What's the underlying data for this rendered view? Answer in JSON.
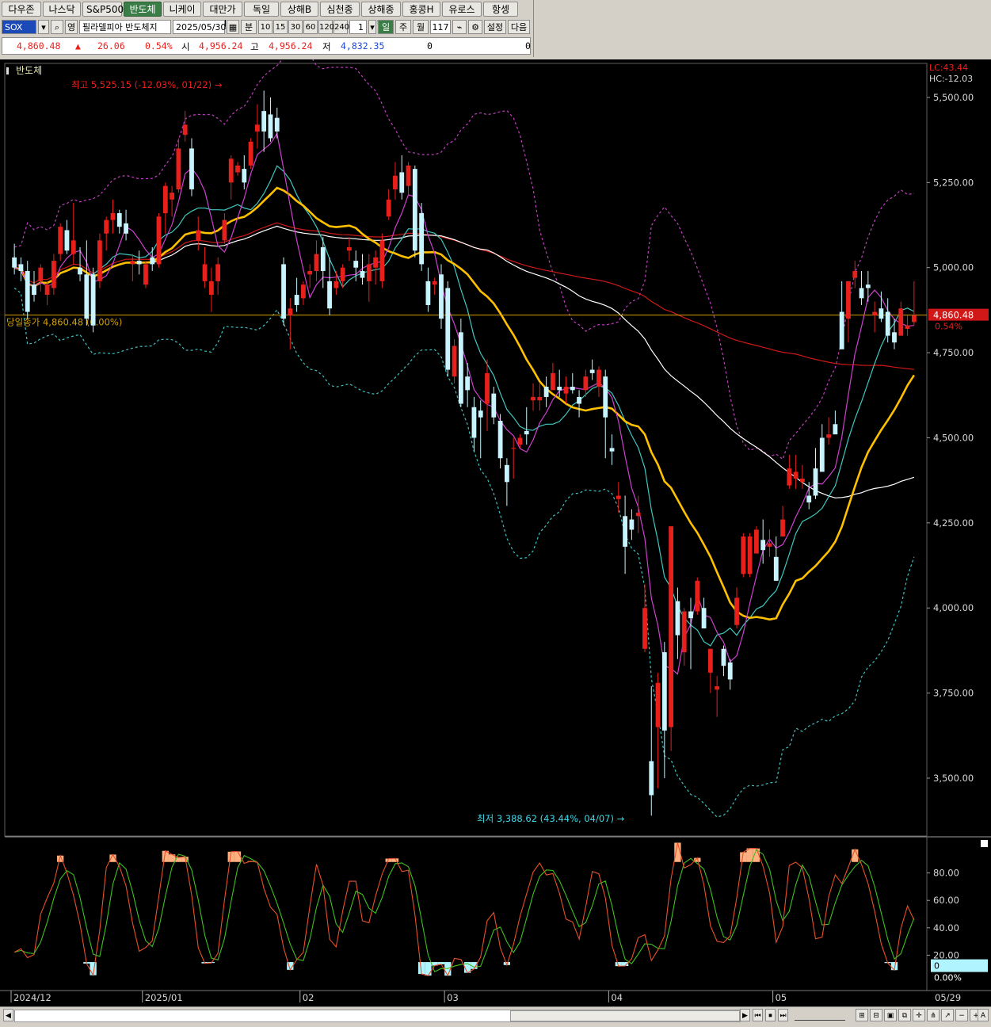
{
  "index_tabs": [
    "다우존스",
    "나스닥",
    "S&P500",
    "반도체",
    "니케이",
    "대만가권",
    "독일",
    "상해B",
    "심천종합",
    "상해종합",
    "홍콩H",
    "유로스톡",
    "항셍"
  ],
  "active_tab": 3,
  "toolbar": {
    "symbol": "SOX",
    "name": "필라델피아 반도체지",
    "date": "2025/05/30",
    "unit": "분",
    "periods": [
      "10",
      "15",
      "30",
      "60",
      "120",
      "240"
    ],
    "count": "1",
    "day": "일",
    "week": "주",
    "month": "월",
    "bars": "117",
    "settings": "설정",
    "next": "다음"
  },
  "quote": {
    "price": "4,860.48",
    "change_arrow": "▲",
    "change": "26.06",
    "change_pct": "0.54%",
    "open_label": "시",
    "open": "4,956.24",
    "high_label": "고",
    "high": "4,956.24",
    "low_label": "저",
    "low": "4,832.35",
    "vol1": "0",
    "vol2": "0"
  },
  "chart_data": {
    "type": "candlestick",
    "title": "반도체",
    "ylim": [
      3330,
      5600
    ],
    "yticks": [
      "5,500.00",
      "5,250.00",
      "5,000.00",
      "4,750.00",
      "4,500.00",
      "4,250.00",
      "4,000.00",
      "3,750.00",
      "3,500.00"
    ],
    "ytick_values": [
      5500,
      5250,
      5000,
      4750,
      4500,
      4250,
      4000,
      3750,
      3500
    ],
    "xticks": [
      "2024/12",
      "2025/01",
      "02",
      "03",
      "04",
      "05"
    ],
    "xtick_index": [
      0,
      20,
      44,
      66,
      91,
      116
    ],
    "last_bar_label": "05/29",
    "max_label": "최고 5,525.15 (-12.03%, 01/22)",
    "min_label": "최저 3,388.62 (43.44%, 04/07)",
    "close_line_label": "당일종가 4,860.48 (0.00%)",
    "close_line_value": 4860.48,
    "price_tag": "4,860.48",
    "price_tag_pct": "0.54%",
    "lc_label": "LC:43.44",
    "hc_label": "HC:-12.03",
    "colors": {
      "up": "#e8201c",
      "down": "#c8f4ff",
      "ma5": "#d040d0",
      "ma10": "#40c8c0",
      "ma20": "#ffc000",
      "ma60": "#ffffff",
      "ma120": "#d01818",
      "band_upper": "#c040c0",
      "band_lower": "#40c0c0",
      "close_line": "#d4a000",
      "osc_fast": "#e8502a",
      "osc_slow": "#40c020",
      "osc_high_fill": "#ffb080",
      "osc_low_fill": "#b0f4ff"
    },
    "candles": [
      [
        5030,
        5070,
        4980,
        5000
      ],
      [
        5010,
        5030,
        4960,
        4990
      ],
      [
        4990,
        5020,
        4850,
        4870
      ],
      [
        4950,
        4990,
        4900,
        4920
      ],
      [
        4960,
        5010,
        4930,
        5000
      ],
      [
        4920,
        4960,
        4890,
        4950
      ],
      [
        4940,
        5040,
        4920,
        5020
      ],
      [
        5040,
        5130,
        5020,
        5120
      ],
      [
        5110,
        5140,
        5040,
        5050
      ],
      [
        5040,
        5190,
        5010,
        5080
      ],
      [
        5000,
        5060,
        4960,
        4980
      ],
      [
        4980,
        5080,
        4830,
        4850
      ],
      [
        4980,
        5000,
        4810,
        4830
      ],
      [
        4960,
        5100,
        4940,
        5080
      ],
      [
        5100,
        5150,
        5050,
        5140
      ],
      [
        5140,
        5200,
        5100,
        5160
      ],
      [
        5160,
        5170,
        5100,
        5120
      ],
      [
        5130,
        5170,
        5080,
        5100
      ],
      [
        5010,
        5040,
        4960,
        5020
      ],
      [
        5020,
        5050,
        4980,
        5010
      ],
      [
        4950,
        5020,
        4940,
        5010
      ],
      [
        5030,
        5060,
        4990,
        5010
      ],
      [
        5010,
        5160,
        5000,
        5150
      ],
      [
        5160,
        5250,
        5100,
        5240
      ],
      [
        5200,
        5240,
        5150,
        5220
      ],
      [
        5230,
        5380,
        5220,
        5350
      ],
      [
        5390,
        5460,
        5370,
        5420
      ],
      [
        5350,
        5380,
        5210,
        5230
      ],
      [
        5080,
        5150,
        5050,
        5110
      ],
      [
        4960,
        5060,
        4940,
        5010
      ],
      [
        4920,
        5000,
        4870,
        4960
      ],
      [
        4960,
        5030,
        4920,
        5010
      ],
      [
        5080,
        5160,
        5070,
        5140
      ],
      [
        5250,
        5330,
        5200,
        5320
      ],
      [
        5280,
        5310,
        5270,
        5300
      ],
      [
        5290,
        5330,
        5230,
        5250
      ],
      [
        5300,
        5380,
        5290,
        5370
      ],
      [
        5400,
        5480,
        5350,
        5420
      ],
      [
        5460,
        5520,
        5340,
        5400
      ],
      [
        5450,
        5500,
        5370,
        5380
      ],
      [
        5440,
        5470,
        5380,
        5400
      ],
      [
        5010,
        5030,
        4830,
        4850
      ],
      [
        4860,
        4910,
        4760,
        4880
      ],
      [
        4920,
        4970,
        4870,
        4890
      ],
      [
        4910,
        4960,
        4890,
        4950
      ],
      [
        4980,
        5010,
        4940,
        4990
      ],
      [
        4990,
        5080,
        4960,
        5040
      ],
      [
        5060,
        5090,
        4940,
        4990
      ],
      [
        4960,
        5030,
        4860,
        4880
      ],
      [
        4940,
        4990,
        4920,
        4960
      ],
      [
        4960,
        5010,
        4940,
        5000
      ],
      [
        5050,
        5090,
        5020,
        5060
      ],
      [
        5020,
        5050,
        4960,
        5000
      ],
      [
        4990,
        5040,
        4950,
        4970
      ],
      [
        4960,
        5040,
        4900,
        5010
      ],
      [
        5000,
        5050,
        4950,
        5030
      ],
      [
        4960,
        5100,
        4940,
        5080
      ],
      [
        5150,
        5230,
        5140,
        5200
      ],
      [
        5230,
        5310,
        5200,
        5270
      ],
      [
        5280,
        5330,
        5200,
        5220
      ],
      [
        5240,
        5310,
        5210,
        5300
      ],
      [
        5290,
        5300,
        5030,
        5050
      ],
      [
        5160,
        5190,
        4990,
        5010
      ],
      [
        4960,
        5000,
        4870,
        4890
      ],
      [
        4950,
        4970,
        4920,
        4960
      ],
      [
        4980,
        5010,
        4820,
        4850
      ],
      [
        4940,
        4960,
        4680,
        4700
      ],
      [
        4680,
        4790,
        4660,
        4770
      ],
      [
        4810,
        4850,
        4590,
        4600
      ],
      [
        4680,
        4720,
        4590,
        4640
      ],
      [
        4590,
        4620,
        4460,
        4500
      ],
      [
        4580,
        4610,
        4440,
        4560
      ],
      [
        4600,
        4730,
        4520,
        4690
      ],
      [
        4630,
        4650,
        4540,
        4560
      ],
      [
        4550,
        4570,
        4410,
        4440
      ],
      [
        4420,
        4440,
        4300,
        4370
      ],
      [
        4470,
        4500,
        4380,
        4470
      ],
      [
        4480,
        4510,
        4470,
        4500
      ],
      [
        4520,
        4590,
        4480,
        4510
      ],
      [
        4610,
        4660,
        4580,
        4620
      ],
      [
        4610,
        4660,
        4580,
        4620
      ],
      [
        4650,
        4680,
        4590,
        4620
      ],
      [
        4640,
        4720,
        4640,
        4690
      ],
      [
        4650,
        4700,
        4620,
        4640
      ],
      [
        4630,
        4680,
        4600,
        4650
      ],
      [
        4650,
        4690,
        4630,
        4640
      ],
      [
        4620,
        4640,
        4560,
        4600
      ],
      [
        4640,
        4700,
        4620,
        4680
      ],
      [
        4700,
        4730,
        4670,
        4690
      ],
      [
        4650,
        4710,
        4620,
        4700
      ],
      [
        4680,
        4700,
        4440,
        4560
      ],
      [
        4470,
        4510,
        4420,
        4460
      ],
      [
        4320,
        4370,
        4280,
        4330
      ],
      [
        4270,
        4330,
        4100,
        4180
      ],
      [
        4260,
        4290,
        4200,
        4230
      ],
      [
        4270,
        4330,
        4220,
        4280
      ],
      [
        3880,
        4070,
        3870,
        4000
      ],
      [
        3550,
        3770,
        3390,
        3450
      ],
      [
        3650,
        3810,
        3470,
        3780
      ],
      [
        3870,
        3900,
        3500,
        3640
      ],
      [
        3650,
        4000,
        3580,
        4240
      ],
      [
        4020,
        4060,
        3850,
        3920
      ],
      [
        3870,
        4000,
        3830,
        3990
      ],
      [
        3990,
        4030,
        3820,
        3970
      ],
      [
        3990,
        4090,
        3980,
        4080
      ],
      [
        4000,
        4030,
        3940,
        3940
      ],
      [
        3810,
        3880,
        3750,
        3880
      ],
      [
        3760,
        3800,
        3680,
        3770
      ],
      [
        3880,
        3890,
        3800,
        3830
      ],
      [
        3840,
        3850,
        3760,
        3790
      ],
      [
        3950,
        4060,
        3940,
        4030
      ],
      [
        4100,
        4220,
        4090,
        4210
      ],
      [
        4100,
        4220,
        4090,
        4210
      ],
      [
        4160,
        4240,
        4160,
        4230
      ],
      [
        4200,
        4260,
        4130,
        4170
      ],
      [
        4180,
        4230,
        4150,
        4190
      ],
      [
        4150,
        4210,
        4080,
        4080
      ],
      [
        4210,
        4300,
        4210,
        4260
      ],
      [
        4360,
        4450,
        4350,
        4410
      ],
      [
        4380,
        4450,
        4350,
        4400
      ],
      [
        4370,
        4420,
        4350,
        4380
      ],
      [
        4330,
        4370,
        4290,
        4310
      ],
      [
        4410,
        4470,
        4320,
        4330
      ],
      [
        4500,
        4540,
        4480,
        4400
      ],
      [
        4500,
        4560,
        4480,
        4510
      ],
      [
        4540,
        4580,
        4520,
        4510
      ],
      [
        4870,
        4960,
        4780,
        4760
      ],
      [
        4850,
        4910,
        4780,
        4960
      ],
      [
        4970,
        5020,
        4940,
        4990
      ],
      [
        4940,
        4990,
        4890,
        4910
      ],
      [
        4950,
        4990,
        4900,
        4940
      ],
      [
        4860,
        4900,
        4810,
        4870
      ],
      [
        4880,
        4930,
        4840,
        4850
      ],
      [
        4870,
        4910,
        4780,
        4800
      ],
      [
        4810,
        4850,
        4760,
        4780
      ],
      [
        4800,
        4900,
        4800,
        4880
      ],
      [
        4820,
        4860,
        4800,
        4830
      ],
      [
        4840,
        4960,
        4830,
        4860
      ]
    ],
    "osc_yticks": [
      "80.00",
      "60.00",
      "40.00",
      "20.00"
    ],
    "osc_ytick_values": [
      80,
      60,
      40,
      20
    ],
    "osc_ylim": [
      0,
      100
    ],
    "osc_tag": "0",
    "osc_tag_pct": "0.00%"
  },
  "bottom": {
    "buttons": [
      "◀",
      "▶",
      "⏮",
      "⏹",
      "⏭",
      "A"
    ]
  }
}
